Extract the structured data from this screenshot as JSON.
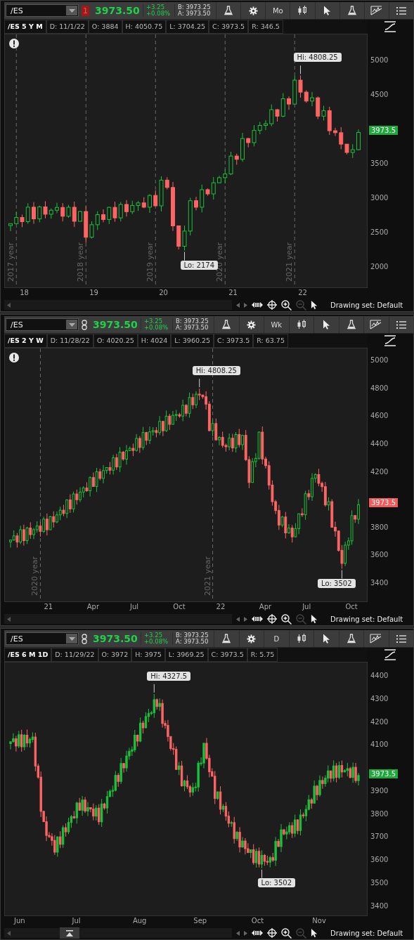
{
  "panels": [
    {
      "toolbar": {
        "symbol": "/ES",
        "badge": {
          "kind": "alert",
          "text": "1"
        },
        "price": "3973.50",
        "change": "+3.25",
        "change_percent": "+0.08%",
        "bid": "B: 3973.25",
        "ask": "A: 3973.50",
        "buttons": [
          {
            "kind": "flask"
          },
          {
            "kind": "gear"
          },
          {
            "kind": "period",
            "text": "Mo"
          },
          {
            "kind": "candles"
          },
          {
            "kind": "cursor"
          },
          {
            "kind": "flask"
          },
          {
            "kind": "drawing"
          },
          {
            "kind": "list"
          }
        ]
      },
      "info": [
        "/ES 5 Y M",
        "D: 11/1/22",
        "O: 3884",
        "H: 4050.75",
        "L: 3704.25",
        "C: 3973.5",
        "R: 346.5"
      ],
      "alert": true,
      "year_markers": [
        "2017 year",
        "2018 year",
        "2019 year",
        "2020 year",
        "2021 year"
      ],
      "high_label": "Hi: 4808.25",
      "low_label": "Lo: 2174",
      "y_ticks": [
        "5000",
        "4500",
        "3500",
        "3000",
        "2500",
        "2000"
      ],
      "price_tag": {
        "text": "3973.5",
        "color": "#1fa83c"
      },
      "x_labels": [
        "18",
        "19",
        "20",
        "21",
        "22"
      ],
      "collapse_handle": false,
      "drawing_set": "Drawing set: Default"
    },
    {
      "toolbar": {
        "symbol": "/ES",
        "badge": {
          "kind": "link"
        },
        "price": "3973.50",
        "change": "+3.25",
        "change_percent": "+0.08%",
        "bid": "B: 3973.25",
        "ask": "A: 3973.50",
        "buttons": [
          {
            "kind": "flask"
          },
          {
            "kind": "gear"
          },
          {
            "kind": "period",
            "text": "Wk"
          },
          {
            "kind": "candles"
          },
          {
            "kind": "cursor"
          },
          {
            "kind": "flask"
          },
          {
            "kind": "drawing"
          },
          {
            "kind": "list"
          }
        ]
      },
      "info": [
        "/ES 2 Y W",
        "D: 11/28/22",
        "O: 4020.25",
        "H: 4024",
        "L: 3960.25",
        "C: 3973.5",
        "R: 63.75"
      ],
      "alert": true,
      "year_markers": [
        "2020 year",
        "2021 year"
      ],
      "high_label": "Hi: 4808.25",
      "low_label": "Lo: 3502",
      "y_ticks": [
        "5000",
        "4800",
        "4600",
        "4400",
        "4200",
        "3800",
        "3600",
        "3400"
      ],
      "price_tag": {
        "text": "3973.5",
        "color": "#f05a5a"
      },
      "x_labels": [
        "21",
        "Apr",
        "Jul",
        "Oct",
        "22",
        "Apr",
        "Jul",
        "Oct"
      ],
      "collapse_handle": false,
      "drawing_set": "Drawing set: Default"
    },
    {
      "toolbar": {
        "symbol": "/ES",
        "badge": {
          "kind": "link"
        },
        "price": "3973.50",
        "change": "+3.25",
        "change_percent": "+0.08%",
        "bid": "B: 3973.25",
        "ask": "A: 3973.50",
        "buttons": [
          {
            "kind": "flask"
          },
          {
            "kind": "gear"
          },
          {
            "kind": "period",
            "text": "D"
          },
          {
            "kind": "candles"
          },
          {
            "kind": "cursor"
          },
          {
            "kind": "flask"
          },
          {
            "kind": "drawing"
          },
          {
            "kind": "list"
          }
        ]
      },
      "info": [
        "/ES 6 M 1D",
        "D: 11/29/22",
        "O: 3972",
        "H: 3975",
        "L: 3969.25",
        "C: 3973.5",
        "R: 5.75"
      ],
      "alert": false,
      "high_label": "Hi: 4327.5",
      "low_label": "Lo: 3502",
      "y_ticks": [
        "4400",
        "4300",
        "4200",
        "4100",
        "3900",
        "3800",
        "3700",
        "3600",
        "3500",
        "3400"
      ],
      "price_tag": {
        "text": "3973.5",
        "color": "#1fa83c"
      },
      "x_labels": [
        "Jun",
        "Jul",
        "Aug",
        "Sep",
        "Oct",
        "Nov"
      ],
      "collapse_handle": true,
      "drawing_set": "Drawing set: Default"
    }
  ]
}
